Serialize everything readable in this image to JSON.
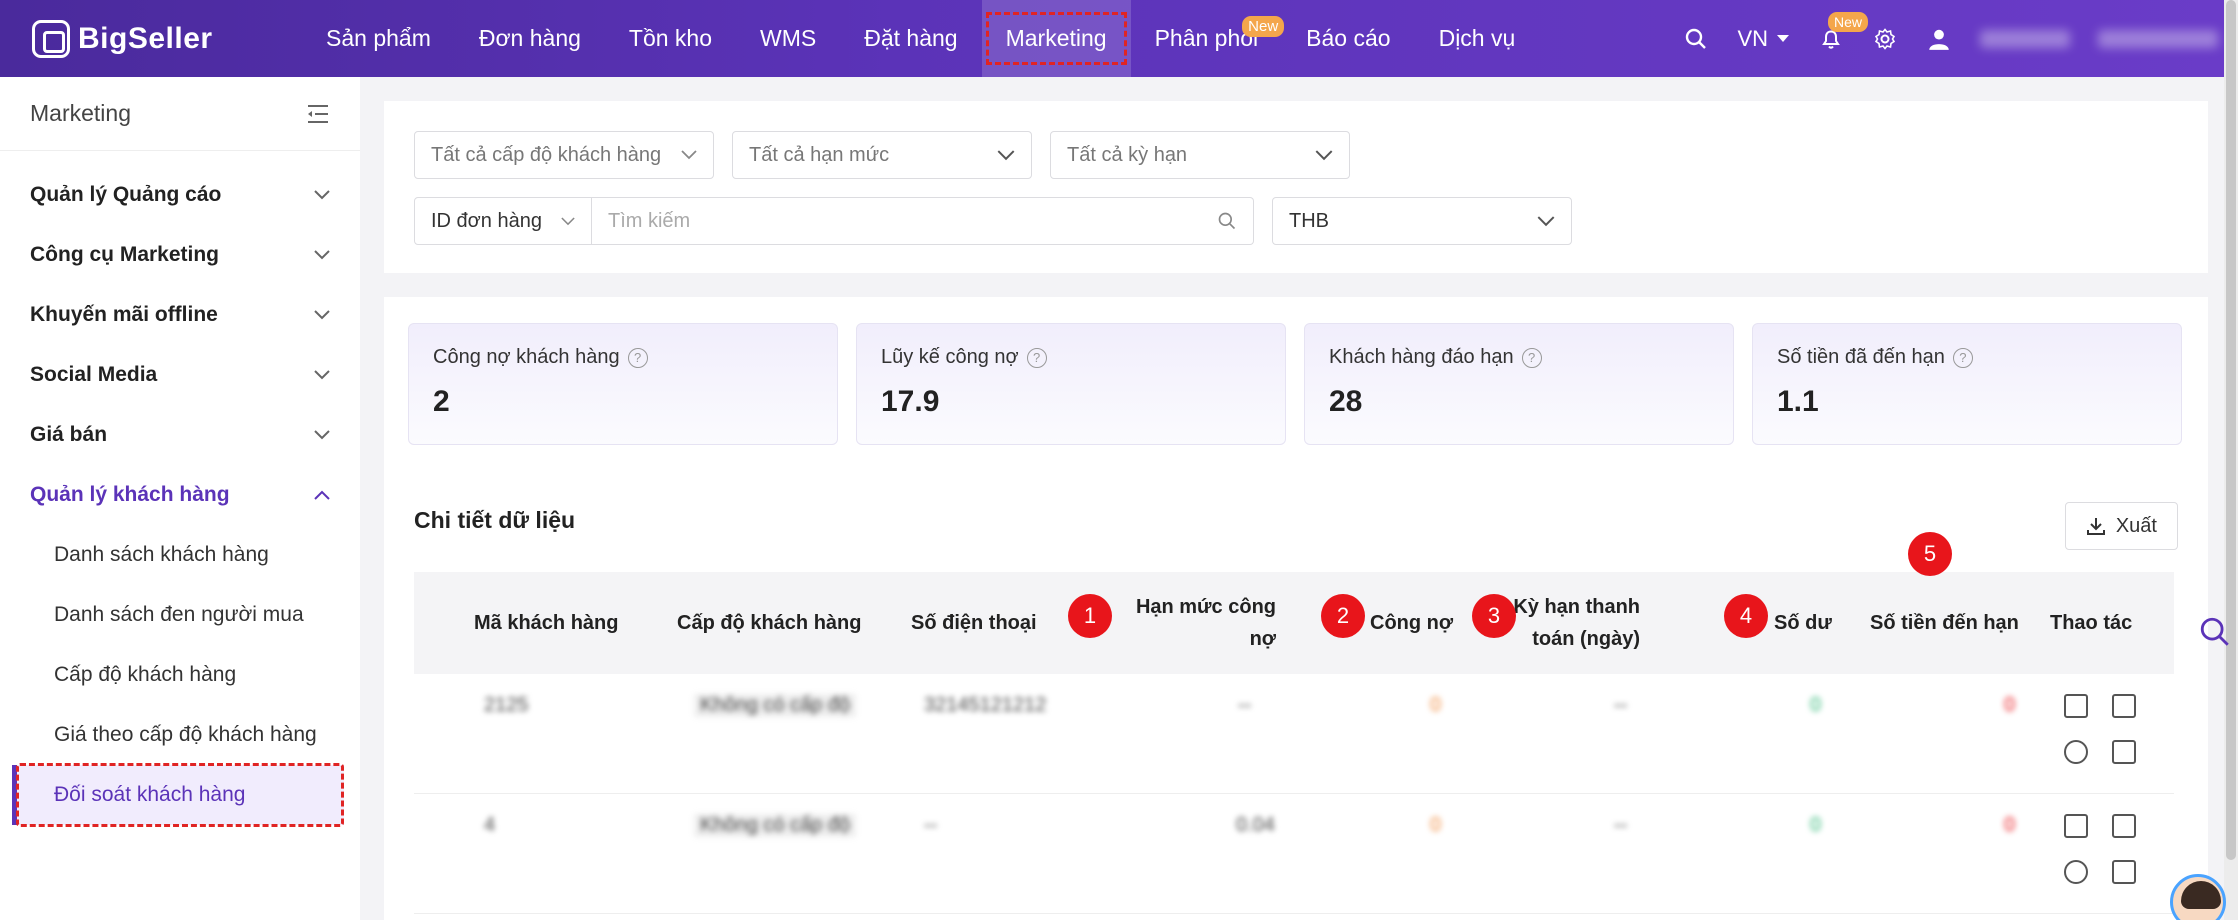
{
  "brand": {
    "name": "BigSeller"
  },
  "nav": {
    "items": [
      {
        "label": "Sản phẩm",
        "active": false
      },
      {
        "label": "Đơn hàng",
        "active": false
      },
      {
        "label": "Tồn kho",
        "active": false
      },
      {
        "label": "WMS",
        "active": false
      },
      {
        "label": "Đặt hàng",
        "active": false
      },
      {
        "label": "Marketing",
        "active": true
      },
      {
        "label": "Phân phối",
        "active": false,
        "badge": "New"
      },
      {
        "label": "Báo cáo",
        "active": false
      },
      {
        "label": "Dịch vụ",
        "active": false
      }
    ],
    "lang": "VN",
    "notification_badge": "New"
  },
  "sidebar": {
    "title": "Marketing",
    "groups": [
      {
        "label": "Quản lý Quảng cáo",
        "open": false
      },
      {
        "label": "Công cụ Marketing",
        "open": false
      },
      {
        "label": "Khuyến mãi offline",
        "open": false
      },
      {
        "label": "Social Media",
        "open": false
      },
      {
        "label": "Giá bán",
        "open": false
      },
      {
        "label": "Quản lý khách hàng",
        "open": true
      }
    ],
    "sub_items": [
      {
        "label": "Danh sách khách hàng",
        "active": false
      },
      {
        "label": "Danh sách đen người mua",
        "active": false
      },
      {
        "label": "Cấp độ khách hàng",
        "active": false
      },
      {
        "label": "Giá theo cấp độ khách hàng",
        "active": false
      },
      {
        "label": "Đối soát khách hàng",
        "active": true
      }
    ]
  },
  "filters": {
    "customer_level": "Tất cả cấp độ khách hàng",
    "credit_limit": "Tất cả hạn mức",
    "term": "Tất cả kỳ hạn",
    "search_type": "ID đơn hàng",
    "search_placeholder": "Tìm kiếm",
    "currency": "THB"
  },
  "stats": [
    {
      "label": "Công nợ khách hàng",
      "value": "2"
    },
    {
      "label": "Lũy kế công nợ",
      "value": "17.9"
    },
    {
      "label": "Khách hàng đáo hạn",
      "value": "28"
    },
    {
      "label": "Số tiền đã đến hạn",
      "value": "1.1"
    }
  ],
  "section": {
    "title": "Chi tiết dữ liệu",
    "export_label": "Xuất"
  },
  "table": {
    "headers": {
      "code": "Mã khách hàng",
      "level": "Cấp độ khách hàng",
      "phone": "Số điện thoại",
      "limit_line1": "Hạn mức công",
      "limit_line2": "nợ",
      "debt": "Công nợ",
      "term_line1": "Kỳ hạn thanh",
      "term_line2": "toán (ngày)",
      "balance": "Số dư",
      "due": "Số tiền đến hạn",
      "action": "Thao tác"
    },
    "markers": [
      "1",
      "2",
      "3",
      "4",
      "5"
    ],
    "rows": [
      {
        "code": "2125",
        "level": "Không có cấp độ",
        "phone": "32145121212",
        "limit": "--",
        "debt": "0",
        "term": "--",
        "balance": "0",
        "due": "0"
      },
      {
        "code": "4",
        "level": "Không có cấp độ",
        "phone": "--",
        "limit": "0.04",
        "debt": "0",
        "term": "--",
        "balance": "0",
        "due": "0"
      }
    ]
  },
  "colors": {
    "primary": "#5b33b8",
    "highlight": "#e02424",
    "marker": "#e8151b",
    "debt": "#f08a3c",
    "balance": "#2bb673",
    "due": "#e8151b"
  }
}
